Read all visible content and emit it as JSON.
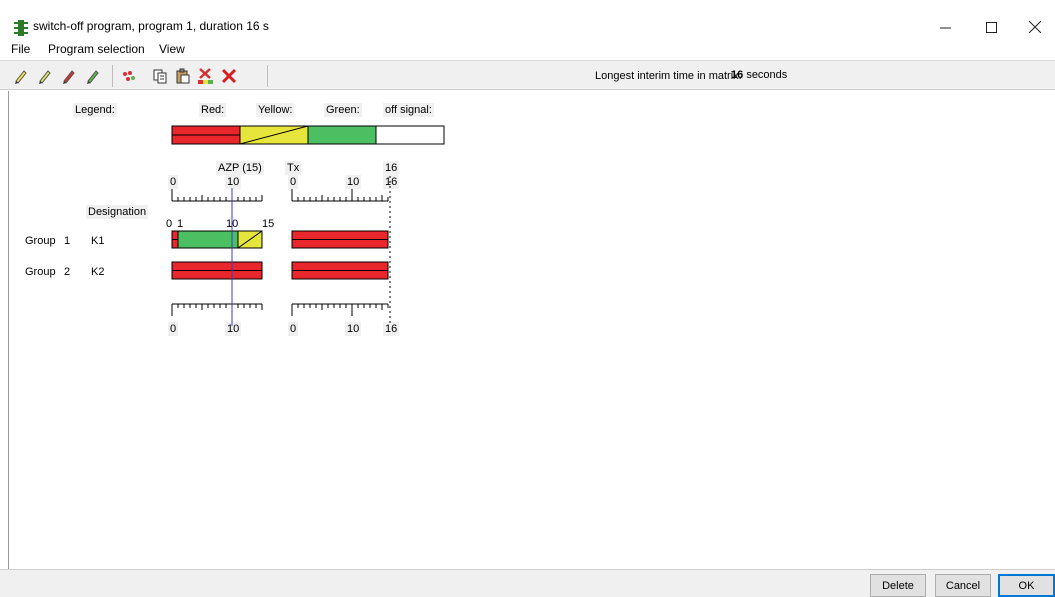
{
  "window": {
    "title": "switch-off program, program 1, duration 16 s",
    "icon": "traffic-light-icon"
  },
  "menu": [
    "File",
    "Program selection",
    "View"
  ],
  "toolbar": {
    "tools": [
      "yellow-pencil-icon",
      "yellow-green-pencil-icon",
      "red-pencil-icon",
      "green-pencil-icon",
      "palette-icon",
      "copy-icon",
      "paste-icon",
      "clear-icon",
      "delete-x-icon"
    ],
    "interim_label": "Longest interim time in matrix:",
    "interim_value": "16",
    "interim_unit": "seconds"
  },
  "legend": {
    "title": "Legend:",
    "red": "Red:",
    "yellow": "Yellow:",
    "green": "Green:",
    "off": "off signal:",
    "colors": {
      "red": "#e8262b",
      "yellow": "#e5e53c",
      "green": "#4bbf62",
      "off": "#ffffff"
    }
  },
  "axes": {
    "azp_label": "AZP (15)",
    "tx_label": "Tx",
    "left_ticks": [
      "0",
      "10"
    ],
    "right_ticks": [
      "0",
      "10",
      "16"
    ],
    "right_end": "16",
    "marker_ticks": [
      "0",
      "1",
      "10",
      "15"
    ]
  },
  "designation_label": "Designation",
  "groups": [
    {
      "group": "Group",
      "number": "1",
      "name": "K1",
      "left_segments": [
        {
          "color": "red",
          "from": 0,
          "to": 1
        },
        {
          "color": "yellow",
          "from": 1,
          "to": 1.2
        },
        {
          "color": "green",
          "from": 1,
          "to": 11
        },
        {
          "color": "yellow",
          "from": 11,
          "to": 15
        }
      ],
      "right_segments": [
        {
          "color": "red",
          "from": 0,
          "to": 16
        }
      ]
    },
    {
      "group": "Group",
      "number": "2",
      "name": "K2",
      "left_segments": [
        {
          "color": "red",
          "from": 0,
          "to": 15
        }
      ],
      "right_segments": [
        {
          "color": "red",
          "from": 0,
          "to": 16
        }
      ]
    }
  ],
  "buttons": {
    "delete": "Delete",
    "cancel": "Cancel",
    "ok": "OK"
  }
}
